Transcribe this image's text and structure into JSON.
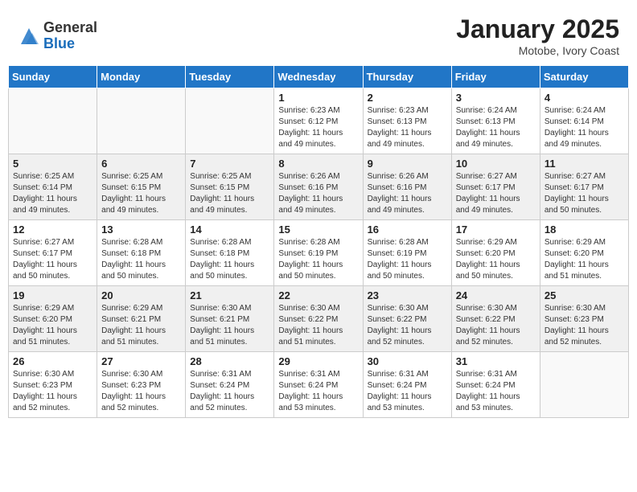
{
  "header": {
    "logo_general": "General",
    "logo_blue": "Blue",
    "title": "January 2025",
    "location": "Motobe, Ivory Coast"
  },
  "weekdays": [
    "Sunday",
    "Monday",
    "Tuesday",
    "Wednesday",
    "Thursday",
    "Friday",
    "Saturday"
  ],
  "weeks": [
    [
      {
        "day": "",
        "info": ""
      },
      {
        "day": "",
        "info": ""
      },
      {
        "day": "",
        "info": ""
      },
      {
        "day": "1",
        "info": "Sunrise: 6:23 AM\nSunset: 6:12 PM\nDaylight: 11 hours\nand 49 minutes."
      },
      {
        "day": "2",
        "info": "Sunrise: 6:23 AM\nSunset: 6:13 PM\nDaylight: 11 hours\nand 49 minutes."
      },
      {
        "day": "3",
        "info": "Sunrise: 6:24 AM\nSunset: 6:13 PM\nDaylight: 11 hours\nand 49 minutes."
      },
      {
        "day": "4",
        "info": "Sunrise: 6:24 AM\nSunset: 6:14 PM\nDaylight: 11 hours\nand 49 minutes."
      }
    ],
    [
      {
        "day": "5",
        "info": "Sunrise: 6:25 AM\nSunset: 6:14 PM\nDaylight: 11 hours\nand 49 minutes."
      },
      {
        "day": "6",
        "info": "Sunrise: 6:25 AM\nSunset: 6:15 PM\nDaylight: 11 hours\nand 49 minutes."
      },
      {
        "day": "7",
        "info": "Sunrise: 6:25 AM\nSunset: 6:15 PM\nDaylight: 11 hours\nand 49 minutes."
      },
      {
        "day": "8",
        "info": "Sunrise: 6:26 AM\nSunset: 6:16 PM\nDaylight: 11 hours\nand 49 minutes."
      },
      {
        "day": "9",
        "info": "Sunrise: 6:26 AM\nSunset: 6:16 PM\nDaylight: 11 hours\nand 49 minutes."
      },
      {
        "day": "10",
        "info": "Sunrise: 6:27 AM\nSunset: 6:17 PM\nDaylight: 11 hours\nand 49 minutes."
      },
      {
        "day": "11",
        "info": "Sunrise: 6:27 AM\nSunset: 6:17 PM\nDaylight: 11 hours\nand 50 minutes."
      }
    ],
    [
      {
        "day": "12",
        "info": "Sunrise: 6:27 AM\nSunset: 6:17 PM\nDaylight: 11 hours\nand 50 minutes."
      },
      {
        "day": "13",
        "info": "Sunrise: 6:28 AM\nSunset: 6:18 PM\nDaylight: 11 hours\nand 50 minutes."
      },
      {
        "day": "14",
        "info": "Sunrise: 6:28 AM\nSunset: 6:18 PM\nDaylight: 11 hours\nand 50 minutes."
      },
      {
        "day": "15",
        "info": "Sunrise: 6:28 AM\nSunset: 6:19 PM\nDaylight: 11 hours\nand 50 minutes."
      },
      {
        "day": "16",
        "info": "Sunrise: 6:28 AM\nSunset: 6:19 PM\nDaylight: 11 hours\nand 50 minutes."
      },
      {
        "day": "17",
        "info": "Sunrise: 6:29 AM\nSunset: 6:20 PM\nDaylight: 11 hours\nand 50 minutes."
      },
      {
        "day": "18",
        "info": "Sunrise: 6:29 AM\nSunset: 6:20 PM\nDaylight: 11 hours\nand 51 minutes."
      }
    ],
    [
      {
        "day": "19",
        "info": "Sunrise: 6:29 AM\nSunset: 6:20 PM\nDaylight: 11 hours\nand 51 minutes."
      },
      {
        "day": "20",
        "info": "Sunrise: 6:29 AM\nSunset: 6:21 PM\nDaylight: 11 hours\nand 51 minutes."
      },
      {
        "day": "21",
        "info": "Sunrise: 6:30 AM\nSunset: 6:21 PM\nDaylight: 11 hours\nand 51 minutes."
      },
      {
        "day": "22",
        "info": "Sunrise: 6:30 AM\nSunset: 6:22 PM\nDaylight: 11 hours\nand 51 minutes."
      },
      {
        "day": "23",
        "info": "Sunrise: 6:30 AM\nSunset: 6:22 PM\nDaylight: 11 hours\nand 52 minutes."
      },
      {
        "day": "24",
        "info": "Sunrise: 6:30 AM\nSunset: 6:22 PM\nDaylight: 11 hours\nand 52 minutes."
      },
      {
        "day": "25",
        "info": "Sunrise: 6:30 AM\nSunset: 6:23 PM\nDaylight: 11 hours\nand 52 minutes."
      }
    ],
    [
      {
        "day": "26",
        "info": "Sunrise: 6:30 AM\nSunset: 6:23 PM\nDaylight: 11 hours\nand 52 minutes."
      },
      {
        "day": "27",
        "info": "Sunrise: 6:30 AM\nSunset: 6:23 PM\nDaylight: 11 hours\nand 52 minutes."
      },
      {
        "day": "28",
        "info": "Sunrise: 6:31 AM\nSunset: 6:24 PM\nDaylight: 11 hours\nand 52 minutes."
      },
      {
        "day": "29",
        "info": "Sunrise: 6:31 AM\nSunset: 6:24 PM\nDaylight: 11 hours\nand 53 minutes."
      },
      {
        "day": "30",
        "info": "Sunrise: 6:31 AM\nSunset: 6:24 PM\nDaylight: 11 hours\nand 53 minutes."
      },
      {
        "day": "31",
        "info": "Sunrise: 6:31 AM\nSunset: 6:24 PM\nDaylight: 11 hours\nand 53 minutes."
      },
      {
        "day": "",
        "info": ""
      }
    ]
  ]
}
